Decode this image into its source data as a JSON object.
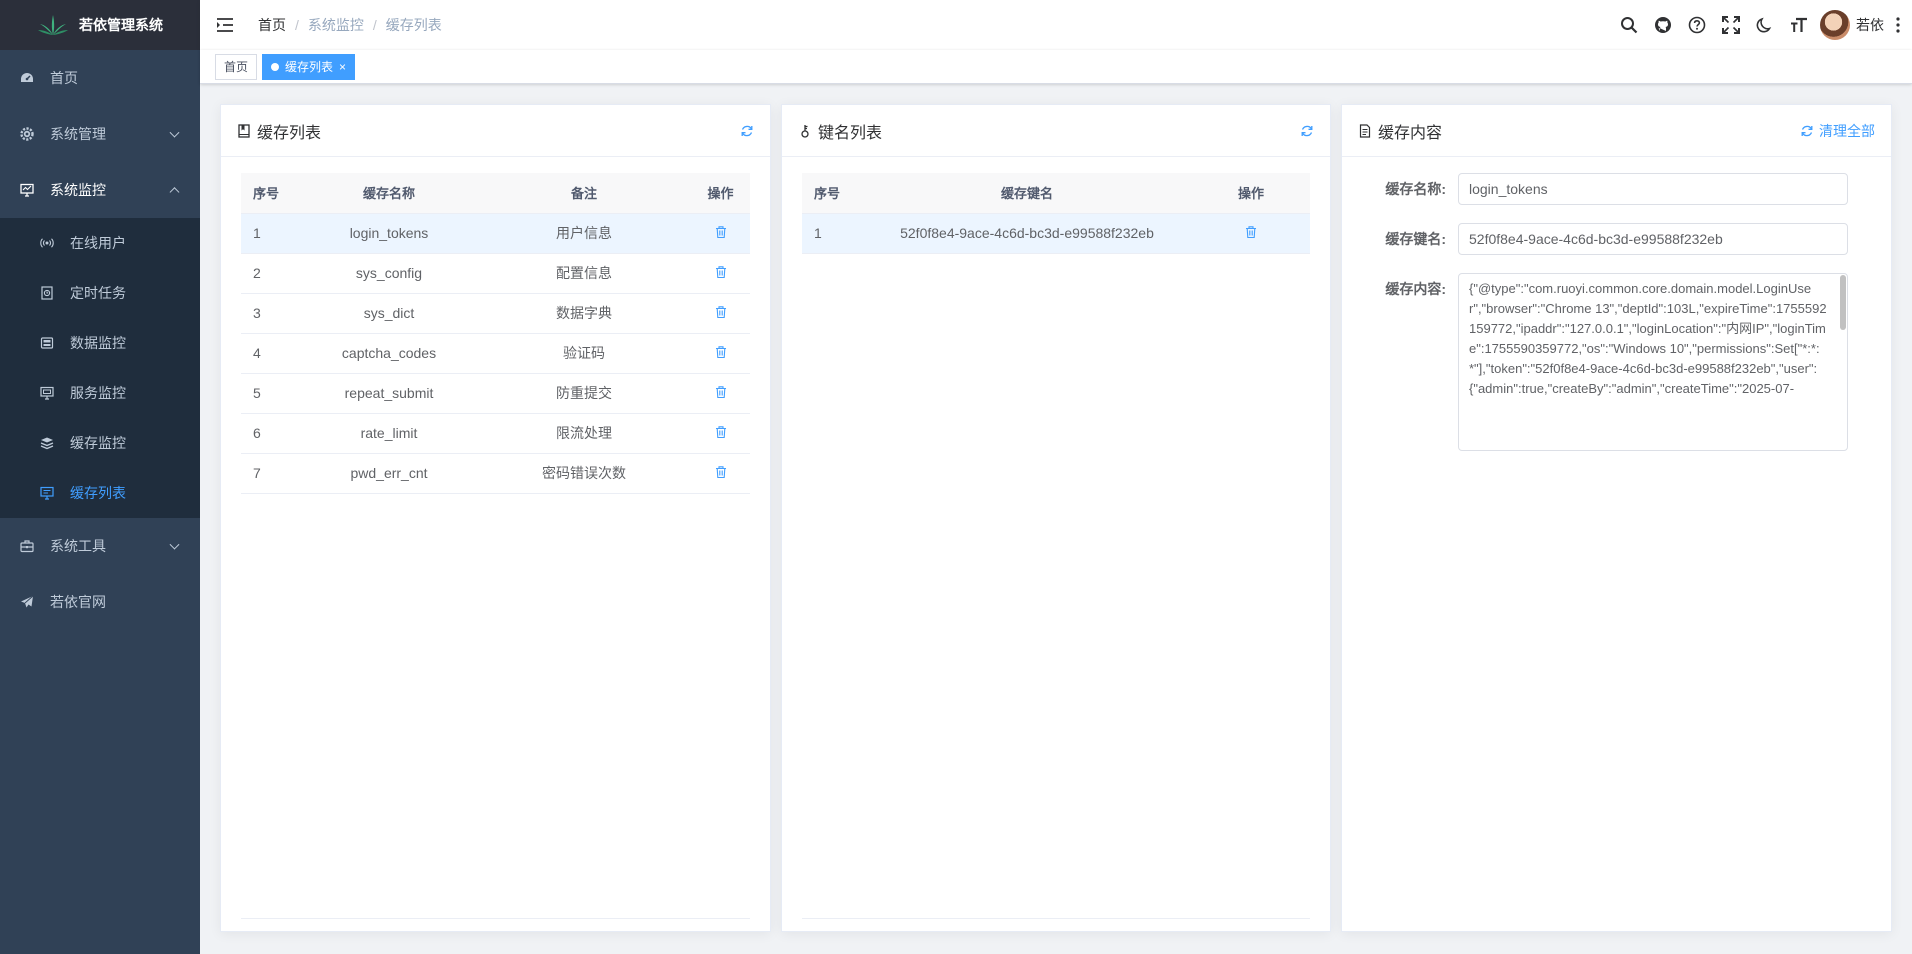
{
  "app": {
    "title": "若依管理系统"
  },
  "sidebar": {
    "items": [
      {
        "label": "首页",
        "icon": "dashboard-icon"
      },
      {
        "label": "系统管理",
        "icon": "gear-icon"
      },
      {
        "label": "系统监控",
        "icon": "monitor-icon"
      },
      {
        "label": "系统工具",
        "icon": "toolbox-icon"
      },
      {
        "label": "若依官网",
        "icon": "paper-plane-icon"
      }
    ],
    "submenu": [
      {
        "label": "在线用户",
        "icon": "online-icon"
      },
      {
        "label": "定时任务",
        "icon": "job-icon"
      },
      {
        "label": "数据监控",
        "icon": "druid-icon"
      },
      {
        "label": "服务监控",
        "icon": "server-icon"
      },
      {
        "label": "缓存监控",
        "icon": "redis-icon"
      },
      {
        "label": "缓存列表",
        "icon": "redis-list-icon"
      }
    ]
  },
  "breadcrumb": [
    "首页",
    "系统监控",
    "缓存列表"
  ],
  "breadcrumb_sep": "/",
  "user": {
    "name": "若依"
  },
  "tags": [
    {
      "label": "首页"
    },
    {
      "label": "缓存列表",
      "close": "×"
    }
  ],
  "cache_list": {
    "title": "缓存列表",
    "columns": [
      "序号",
      "缓存名称",
      "备注",
      "操作"
    ],
    "rows": [
      {
        "no": "1",
        "name": "login_tokens",
        "remark": "用户信息"
      },
      {
        "no": "2",
        "name": "sys_config",
        "remark": "配置信息"
      },
      {
        "no": "3",
        "name": "sys_dict",
        "remark": "数据字典"
      },
      {
        "no": "4",
        "name": "captcha_codes",
        "remark": "验证码"
      },
      {
        "no": "5",
        "name": "repeat_submit",
        "remark": "防重提交"
      },
      {
        "no": "6",
        "name": "rate_limit",
        "remark": "限流处理"
      },
      {
        "no": "7",
        "name": "pwd_err_cnt",
        "remark": "密码错误次数"
      }
    ]
  },
  "key_list": {
    "title": "键名列表",
    "columns": [
      "序号",
      "缓存键名",
      "操作"
    ],
    "rows": [
      {
        "no": "1",
        "key": "52f0f8e4-9ace-4c6d-bc3d-e99588f232eb"
      }
    ]
  },
  "cache_content": {
    "title": "缓存内容",
    "clear_all": "清理全部",
    "name_label": "缓存名称:",
    "name_value": "login_tokens",
    "key_label": "缓存键名:",
    "key_value": "52f0f8e4-9ace-4c6d-bc3d-e99588f232eb",
    "content_label": "缓存内容:",
    "content_value": "{\"@type\":\"com.ruoyi.common.core.domain.model.LoginUser\",\"browser\":\"Chrome 13\",\"deptId\":103L,\"expireTime\":1755592159772,\"ipaddr\":\"127.0.0.1\",\"loginLocation\":\"内网IP\",\"loginTime\":1755590359772,\"os\":\"Windows 10\",\"permissions\":Set[\"*:*:*\"],\"token\":\"52f0f8e4-9ace-4c6d-bc3d-e99588f232eb\",\"user\":{\"admin\":true,\"createBy\":\"admin\",\"createTime\":\"2025-07-"
  },
  "colors": {
    "sidebar_bg": "#304156",
    "submenu_bg": "#1f2d3d",
    "accent": "#409eff",
    "logo_bg": "#2b2f3a"
  }
}
